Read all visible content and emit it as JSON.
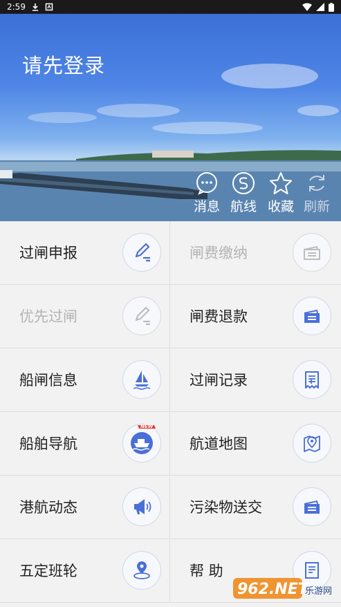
{
  "status_bar": {
    "time": "2:59"
  },
  "hero": {
    "login_prompt": "请先登录"
  },
  "quick_actions": [
    {
      "label": "消息",
      "icon": "chat-bubble-icon",
      "enabled": true
    },
    {
      "label": "航线",
      "icon": "route-icon",
      "enabled": true
    },
    {
      "label": "收藏",
      "icon": "star-icon",
      "enabled": true
    },
    {
      "label": "刷新",
      "icon": "refresh-icon",
      "enabled": false
    }
  ],
  "menu": [
    {
      "label": "过闸申报",
      "icon": "edit-pen-icon",
      "enabled": true
    },
    {
      "label": "闸费缴纳",
      "icon": "ticket-icon",
      "enabled": false
    },
    {
      "label": "优先过闸",
      "icon": "edit-pen-icon",
      "enabled": false
    },
    {
      "label": "闸费退款",
      "icon": "ticket-icon",
      "enabled": true
    },
    {
      "label": "船闸信息",
      "icon": "sailboat-icon",
      "enabled": true
    },
    {
      "label": "过闸记录",
      "icon": "receipt-icon",
      "enabled": true
    },
    {
      "label": "船舶导航",
      "icon": "ship-new-icon",
      "badge": "NEW",
      "enabled": true
    },
    {
      "label": "航道地图",
      "icon": "map-pin-icon",
      "enabled": true
    },
    {
      "label": "港航动态",
      "icon": "megaphone-icon",
      "enabled": true
    },
    {
      "label": "污染物送交",
      "icon": "ticket-icon",
      "enabled": true
    },
    {
      "label": "五定班轮",
      "icon": "location-icon",
      "enabled": true
    },
    {
      "label": "帮 助",
      "icon": "help-doc-icon",
      "enabled": true
    }
  ],
  "watermark": {
    "text": "962.NET",
    "subtext": "乐游网"
  },
  "colors": {
    "accent": "#4a6fd8",
    "disabled": "#b4b4b4"
  }
}
